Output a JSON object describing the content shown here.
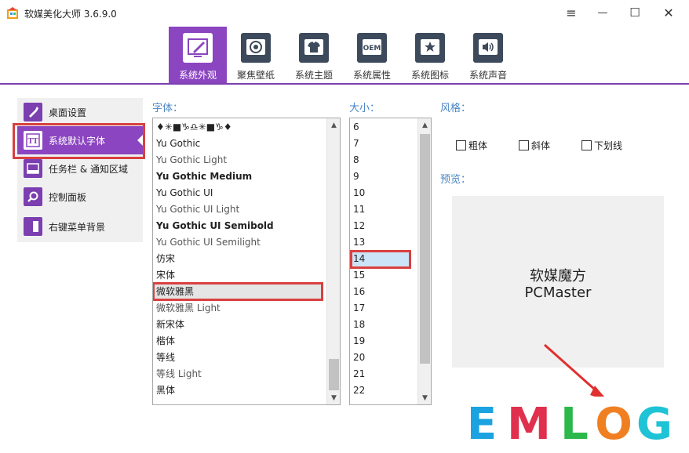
{
  "window": {
    "title": "软媒美化大师 3.6.9.0",
    "controls": [
      "≡",
      "—",
      "☐",
      "✕"
    ]
  },
  "tabs": [
    {
      "label": "系统外观",
      "active": true
    },
    {
      "label": "聚焦壁纸"
    },
    {
      "label": "系统主题"
    },
    {
      "label": "系统属性"
    },
    {
      "label": "系统图标"
    },
    {
      "label": "系统声音"
    }
  ],
  "tab_icons": {
    "oem": "OEM"
  },
  "sidebar": [
    {
      "label": "桌面设置"
    },
    {
      "label": "系统默认字体",
      "active": true
    },
    {
      "label": "任务栏 & 通知区域"
    },
    {
      "label": "控制面板"
    },
    {
      "label": "右键菜单背景"
    }
  ],
  "sidebar_icons": {
    "font": "TT"
  },
  "labels": {
    "font": "字体：",
    "size": "大小：",
    "style": "风格：",
    "preview": "预览："
  },
  "fonts": [
    "♦✳■♑♎✳■♑♦",
    "Yu Gothic",
    "Yu Gothic Light",
    "Yu Gothic Medium",
    "Yu Gothic UI",
    "Yu Gothic UI Light",
    "Yu Gothic UI Semibold",
    "Yu Gothic UI Semilight",
    "仿宋",
    "宋体",
    "微软雅黑",
    "微软雅黑 Light",
    "新宋体",
    "楷体",
    "等线",
    "等线 Light",
    "黑体"
  ],
  "selected_font": "微软雅黑",
  "sizes": [
    "6",
    "7",
    "8",
    "9",
    "10",
    "11",
    "12",
    "13",
    "14",
    "15",
    "16",
    "17",
    "18",
    "19",
    "20",
    "21",
    "22"
  ],
  "selected_size": "14",
  "styles": {
    "bold": "粗体",
    "italic": "斜体",
    "underline": "下划线"
  },
  "preview": {
    "line1": "软媒魔方",
    "line2": "PCMaster"
  },
  "watermark": {
    "letters": [
      "E",
      "M",
      "L",
      "O",
      "G"
    ],
    "colors": [
      "#1aa3e0",
      "#e0304e",
      "#2db84b",
      "#f07f22",
      "#1fc3d6"
    ]
  },
  "colors": {
    "accent": "#8b45c0",
    "label": "#4a86c5",
    "highlight": "#d94040"
  }
}
